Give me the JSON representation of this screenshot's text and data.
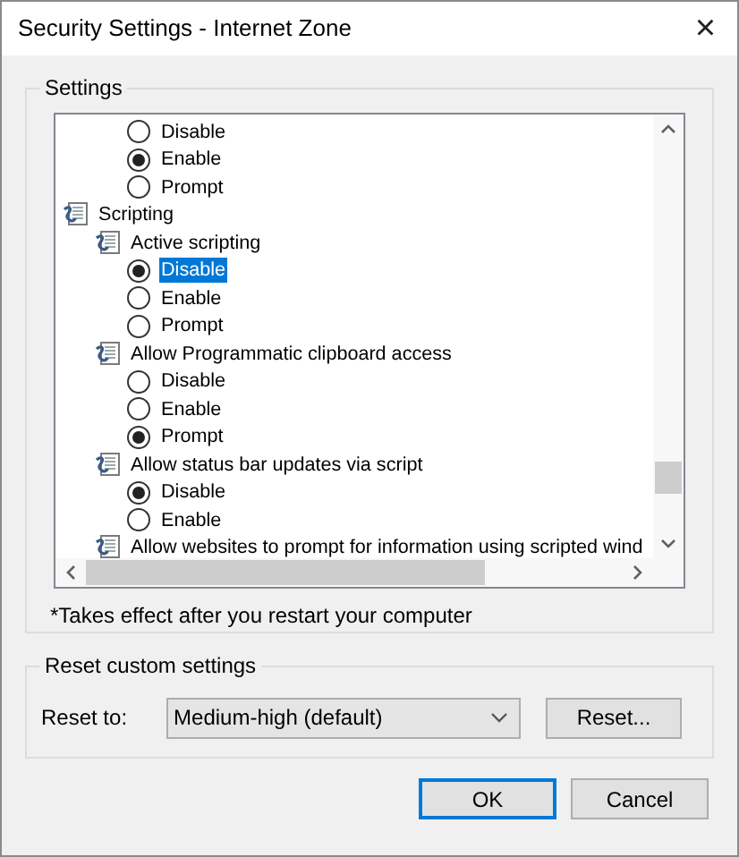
{
  "window": {
    "title": "Security Settings - Internet Zone",
    "close": "×"
  },
  "settings_group": {
    "title": "Settings",
    "continued_options": [
      {
        "label": "Disable",
        "checked": false,
        "selected": false
      },
      {
        "label": "Enable",
        "checked": true,
        "selected": false
      },
      {
        "label": "Prompt",
        "checked": false,
        "selected": false
      }
    ],
    "tree": [
      {
        "kind": "category",
        "label": "Scripting",
        "children": [
          {
            "kind": "setting",
            "label": "Active scripting",
            "children": [
              {
                "kind": "option",
                "label": "Disable",
                "checked": true,
                "selected": true
              },
              {
                "kind": "option",
                "label": "Enable",
                "checked": false,
                "selected": false
              },
              {
                "kind": "option",
                "label": "Prompt",
                "checked": false,
                "selected": false
              }
            ]
          },
          {
            "kind": "setting",
            "label": "Allow Programmatic clipboard access",
            "children": [
              {
                "kind": "option",
                "label": "Disable",
                "checked": false,
                "selected": false
              },
              {
                "kind": "option",
                "label": "Enable",
                "checked": false,
                "selected": false
              },
              {
                "kind": "option",
                "label": "Prompt",
                "checked": true,
                "selected": false
              }
            ]
          },
          {
            "kind": "setting",
            "label": "Allow status bar updates via script",
            "children": [
              {
                "kind": "option",
                "label": "Disable",
                "checked": true,
                "selected": false
              },
              {
                "kind": "option",
                "label": "Enable",
                "checked": false,
                "selected": false
              }
            ]
          },
          {
            "kind": "setting",
            "label": "Allow websites to prompt for information using scripted wind"
          }
        ]
      }
    ],
    "note": "*Takes effect after you restart your computer"
  },
  "reset_group": {
    "title": "Reset custom settings",
    "label": "Reset to:",
    "value": "Medium-high (default)",
    "button": {
      "label": "Reset...",
      "default": false
    }
  },
  "buttons": [
    {
      "label": "OK",
      "default": true
    },
    {
      "label": "Cancel",
      "default": false
    }
  ]
}
